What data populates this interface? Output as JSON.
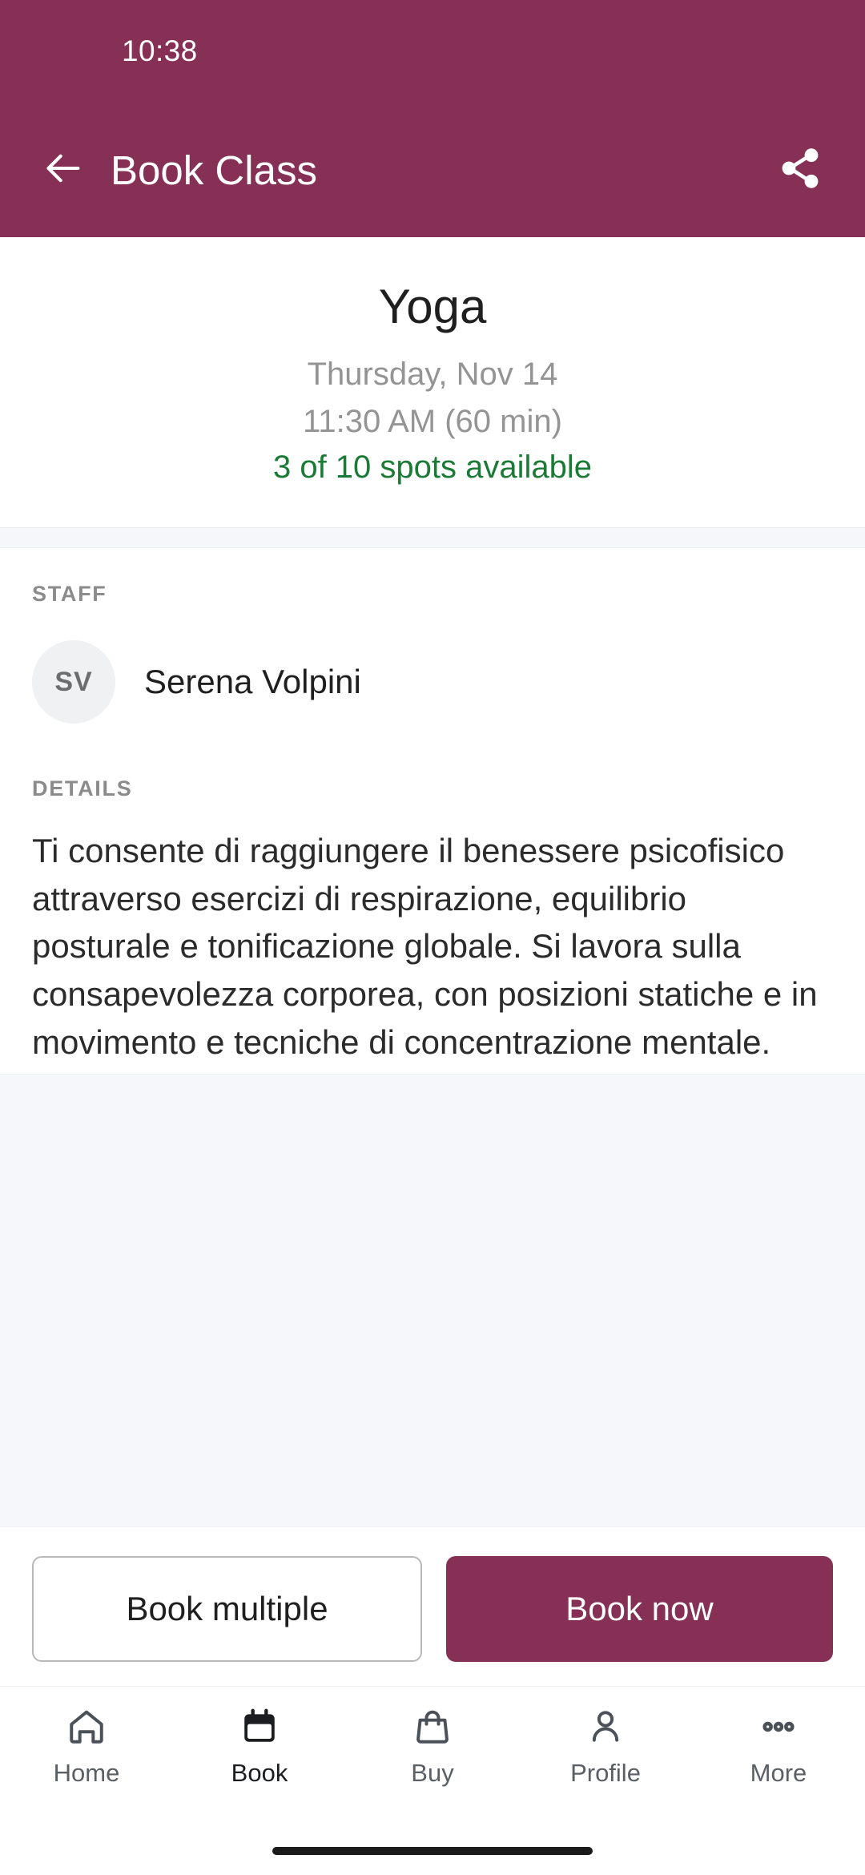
{
  "status_bar": {
    "time": "10:38"
  },
  "appbar": {
    "title": "Book Class",
    "back_icon": "arrow-left-icon",
    "share_icon": "share-icon"
  },
  "hero": {
    "class_name": "Yoga",
    "date": "Thursday, Nov 14",
    "time": "11:30 AM (60 min)",
    "availability": "3 of 10 spots available",
    "availability_color": "#1b7a36"
  },
  "staff": {
    "label": "STAFF",
    "initials": "SV",
    "name": "Serena Volpini"
  },
  "details": {
    "label": "DETAILS",
    "text": "Ti consente di raggiungere il benessere psicofisico attraverso esercizi di respirazione, equilibrio posturale e tonificazione globale. Si lavora sulla consapevolezza corporea, con posizioni statiche e in movimento e tecniche di concentrazione mentale."
  },
  "actions": {
    "book_multiple_label": "Book multiple",
    "book_now_label": "Book now"
  },
  "bottom_nav": {
    "items": [
      {
        "label": "Home",
        "icon": "home-icon",
        "active": false
      },
      {
        "label": "Book",
        "icon": "calendar-icon",
        "active": true
      },
      {
        "label": "Buy",
        "icon": "bag-icon",
        "active": false
      },
      {
        "label": "Profile",
        "icon": "person-icon",
        "active": false
      },
      {
        "label": "More",
        "icon": "ellipsis-icon",
        "active": false
      }
    ]
  },
  "theme": {
    "brand": "#863055",
    "accent_green": "#1b7a36",
    "muted": "#949494",
    "surface": "#ffffff",
    "divider": "#f6f7fa"
  }
}
